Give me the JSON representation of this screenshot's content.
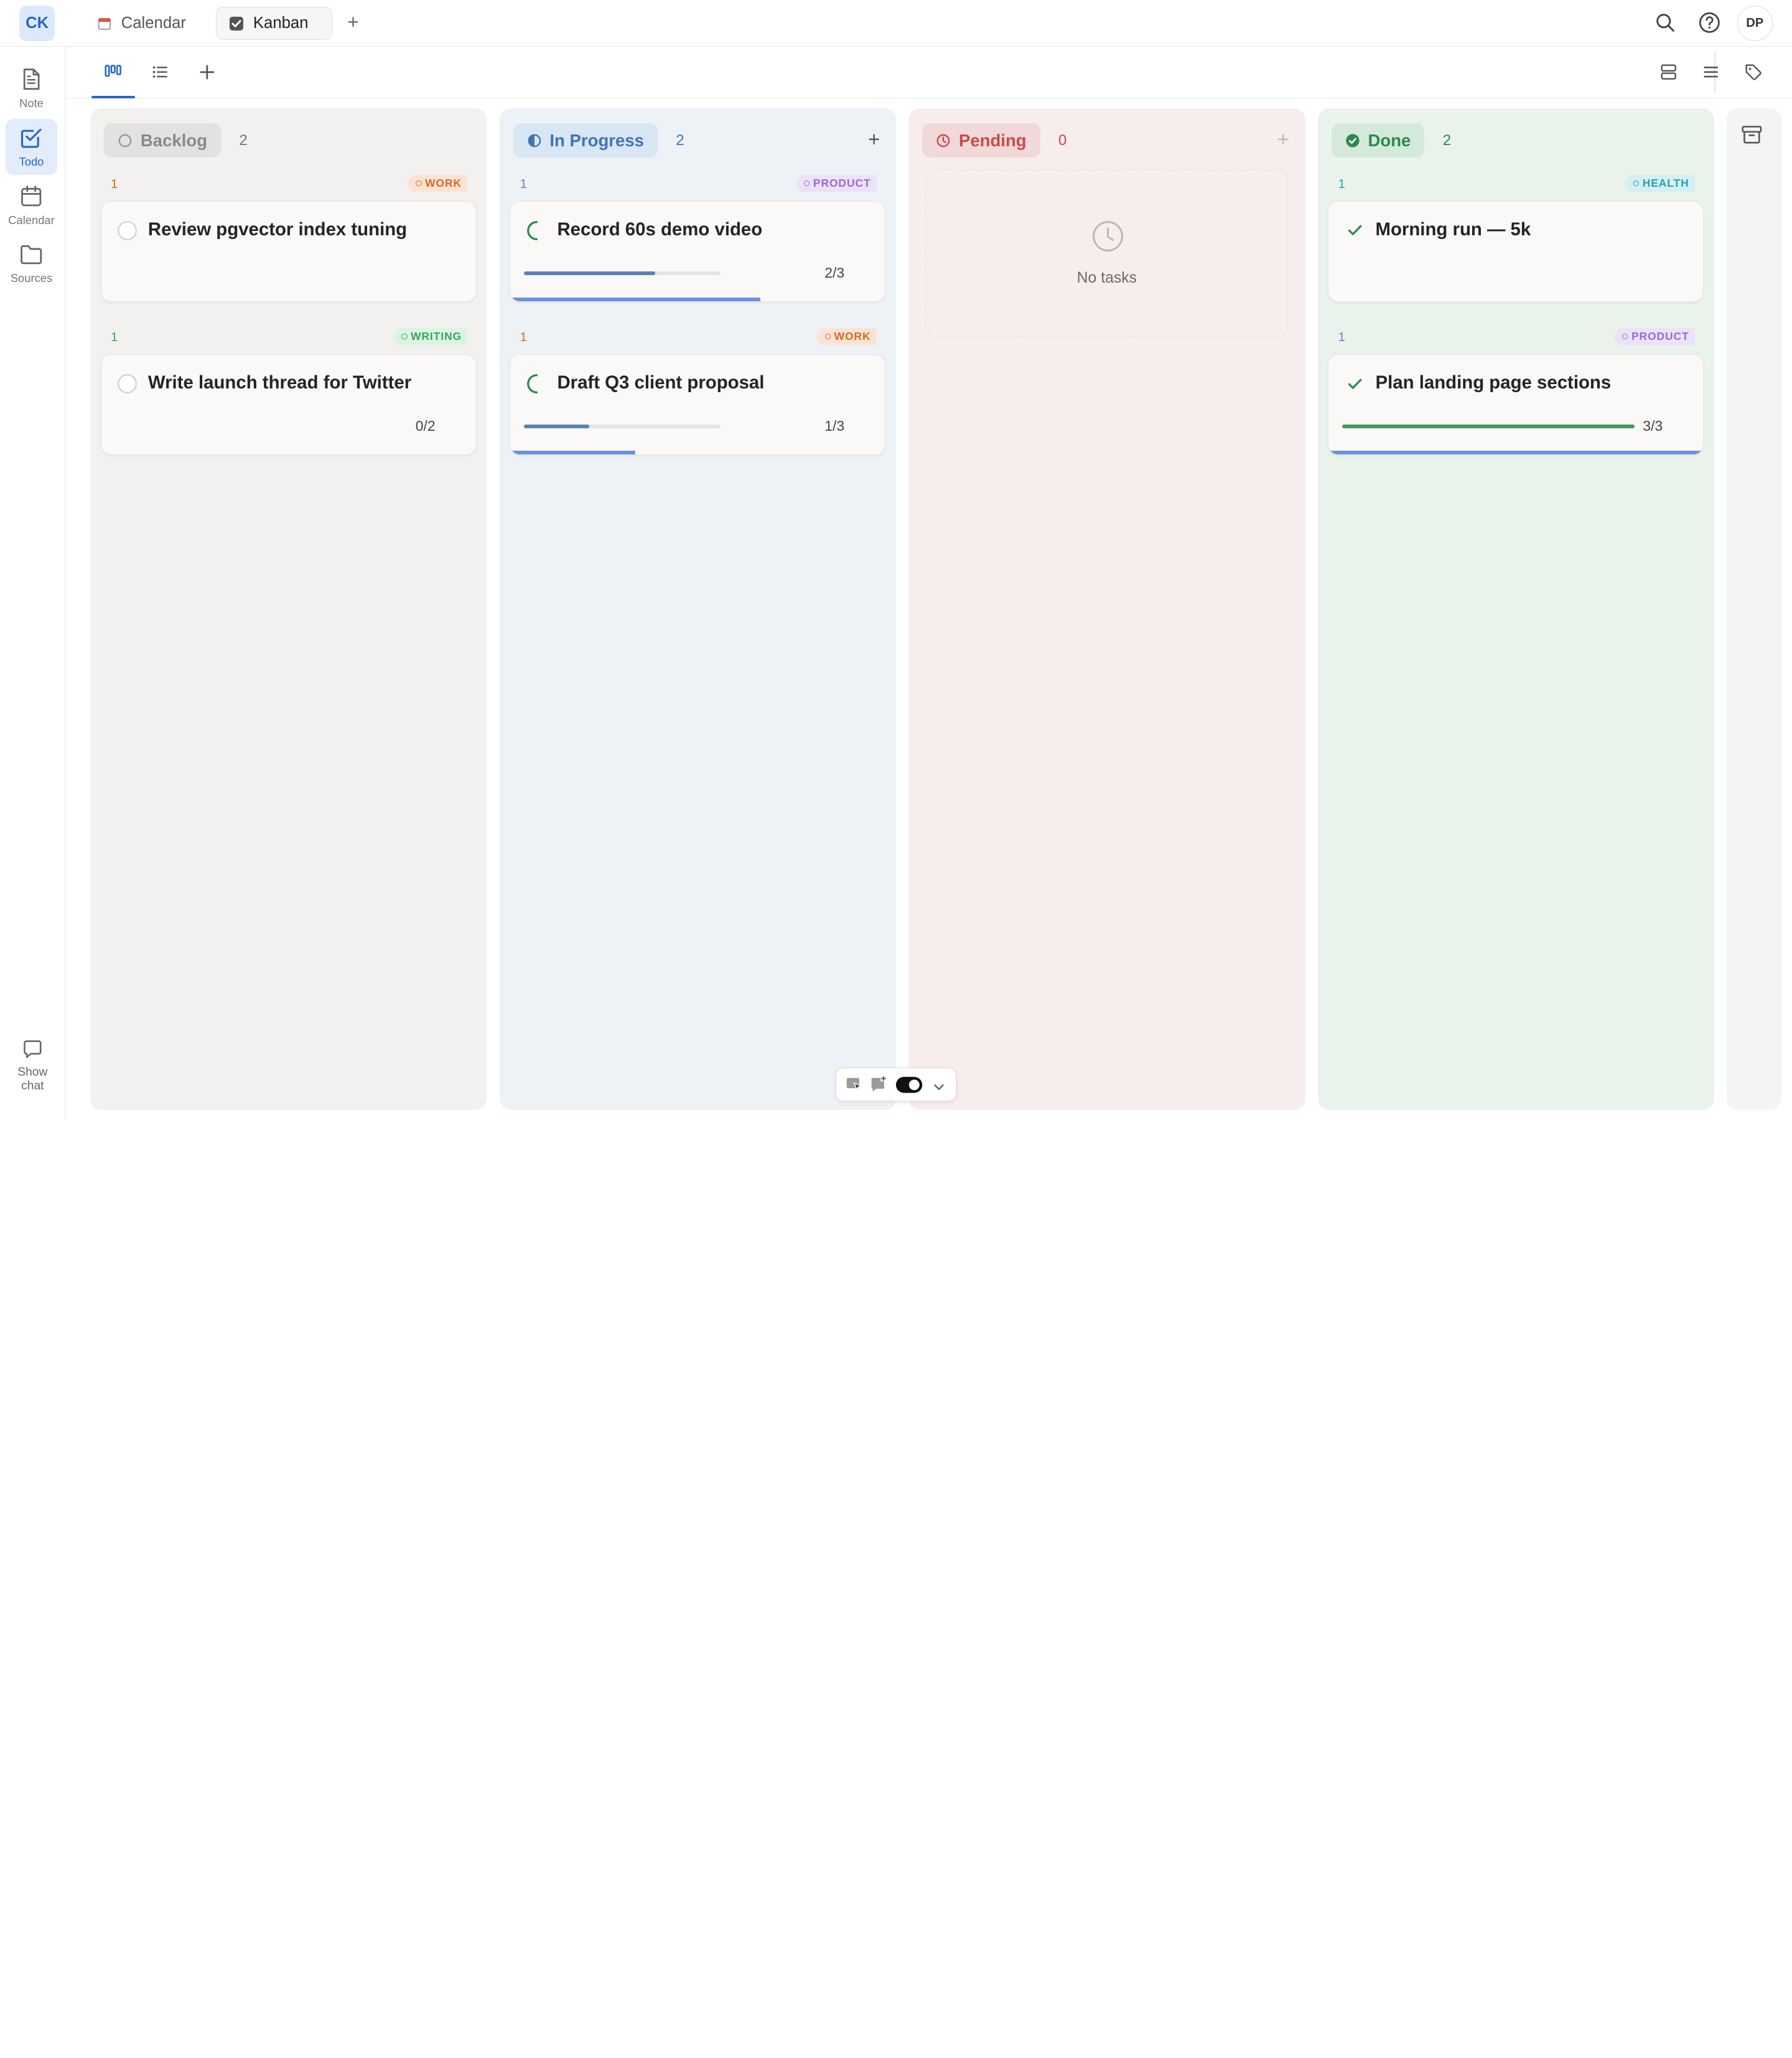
{
  "app": {
    "logo": "CK"
  },
  "tabs": [
    {
      "label": "Calendar",
      "active": false
    },
    {
      "label": "Kanban",
      "active": true
    }
  ],
  "header": {
    "add_tab": "+",
    "avatar": "DP"
  },
  "sidebar": {
    "items": [
      {
        "label": "Note",
        "icon": "note-icon"
      },
      {
        "label": "Todo",
        "icon": "todo-icon",
        "active": true
      },
      {
        "label": "Calendar",
        "icon": "calendar-icon"
      },
      {
        "label": "Sources",
        "icon": "folder-icon"
      }
    ],
    "show_chat": "Show\nchat"
  },
  "board": {
    "add_symbol": "+",
    "columns": [
      {
        "name": "Backlog",
        "count": "2",
        "accent": "#9a9a9a",
        "bg": "#f2f1f0",
        "cards": [
          {
            "priority": "1",
            "tag": "WORK",
            "title": "Review pgvector index tuning",
            "progress": null
          },
          {
            "priority": "1",
            "tag": "WRITING",
            "title": "Write launch thread for Twitter",
            "progress": "0/2"
          }
        ]
      },
      {
        "name": "In Progress",
        "count": "2",
        "accent": "#3f74b7",
        "bg": "#edf2f7",
        "cards": [
          {
            "priority": "1",
            "tag": "PRODUCT",
            "title": "Record 60s demo video",
            "progress": "2/3",
            "progress_value": 0.667
          },
          {
            "priority": "1",
            "tag": "WORK",
            "title": "Draft Q3 client proposal",
            "progress": "1/3",
            "progress_value": 0.333
          }
        ]
      },
      {
        "name": "Pending",
        "count": "0",
        "accent": "#c64b4b",
        "bg": "#f8eded",
        "empty_text": "No tasks"
      },
      {
        "name": "Done",
        "count": "2",
        "accent": "#2d8a4e",
        "bg": "#e9f3ec",
        "cards": [
          {
            "priority": "1",
            "tag": "HEALTH",
            "title": "Morning run — 5k",
            "progress": null
          },
          {
            "priority": "1",
            "tag": "PRODUCT",
            "title": "Plan landing page sections",
            "progress": "3/3",
            "progress_value": 1.0
          }
        ]
      }
    ]
  },
  "colors": {
    "brand": "#2566c9",
    "tag_work": "#d4692a",
    "tag_writing": "#3aa55e",
    "tag_product": "#9a6ad0",
    "tag_health": "#2a9fae"
  }
}
